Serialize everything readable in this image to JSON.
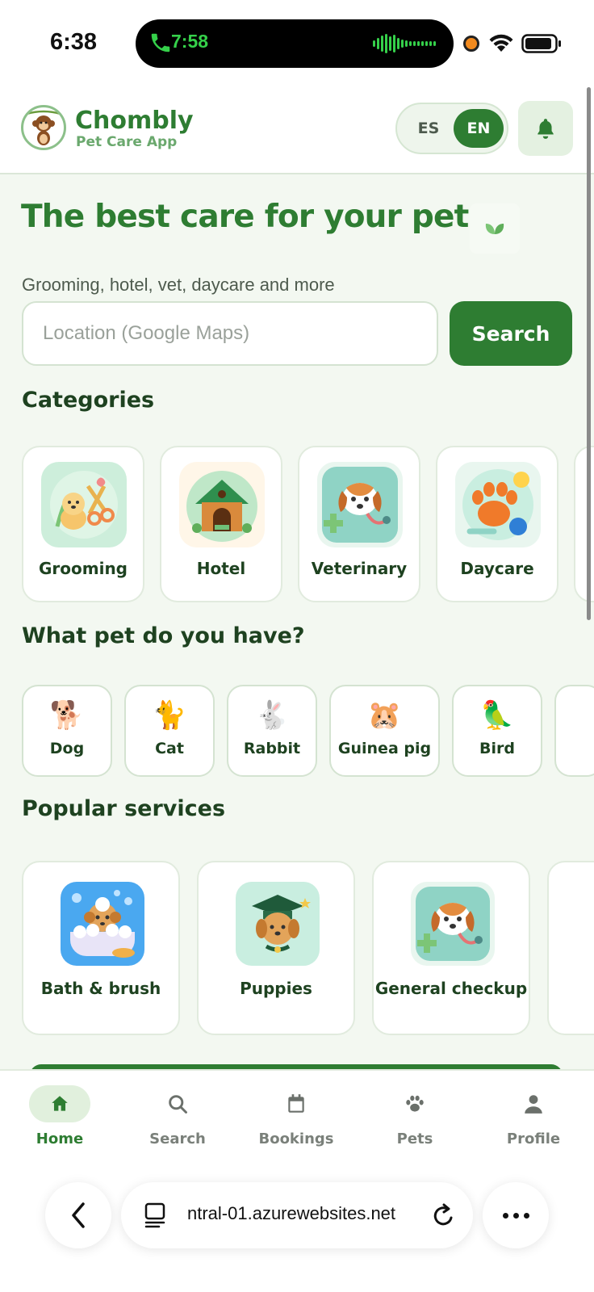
{
  "status_bar": {
    "time": "6:38",
    "island_time": "7:58"
  },
  "header": {
    "brand_name": "Chombly",
    "brand_sub": "Pet Care App",
    "lang_es": "ES",
    "lang_en": "EN",
    "active_lang": "EN"
  },
  "hero": {
    "title": "The best care for your pet",
    "subtitle": "Grooming, hotel, vet, daycare and more",
    "search_placeholder": "Location (Google Maps)",
    "search_button": "Search"
  },
  "categories": {
    "title": "Categories",
    "items": [
      {
        "label": "Grooming",
        "icon": "grooming-icon"
      },
      {
        "label": "Hotel",
        "icon": "hotel-icon"
      },
      {
        "label": "Veterinary",
        "icon": "veterinary-icon"
      },
      {
        "label": "Daycare",
        "icon": "daycare-icon"
      }
    ]
  },
  "pets": {
    "title": "What pet do you have?",
    "items": [
      {
        "label": "Dog",
        "emoji": "🐕"
      },
      {
        "label": "Cat",
        "emoji": "🐈"
      },
      {
        "label": "Rabbit",
        "emoji": "🐇"
      },
      {
        "label": "Guinea pig",
        "emoji": "🐹"
      },
      {
        "label": "Bird",
        "emoji": "🦜"
      }
    ]
  },
  "services": {
    "title": "Popular services",
    "items": [
      {
        "label": "Bath & brush",
        "icon": "bath-icon"
      },
      {
        "label": "Puppies",
        "icon": "puppy-graduate-icon"
      },
      {
        "label": "General checkup",
        "icon": "checkup-icon"
      }
    ]
  },
  "bottom_nav": {
    "items": [
      {
        "label": "Home",
        "icon": "home-icon",
        "active": true
      },
      {
        "label": "Search",
        "icon": "search-icon",
        "active": false
      },
      {
        "label": "Bookings",
        "icon": "calendar-icon",
        "active": false
      },
      {
        "label": "Pets",
        "icon": "paw-icon",
        "active": false
      },
      {
        "label": "Profile",
        "icon": "user-icon",
        "active": false
      }
    ]
  },
  "browser": {
    "url": "ntral-01.azurewebsites.net"
  },
  "colors": {
    "brand_green": "#2e7d32",
    "background": "#f3f8f1"
  }
}
